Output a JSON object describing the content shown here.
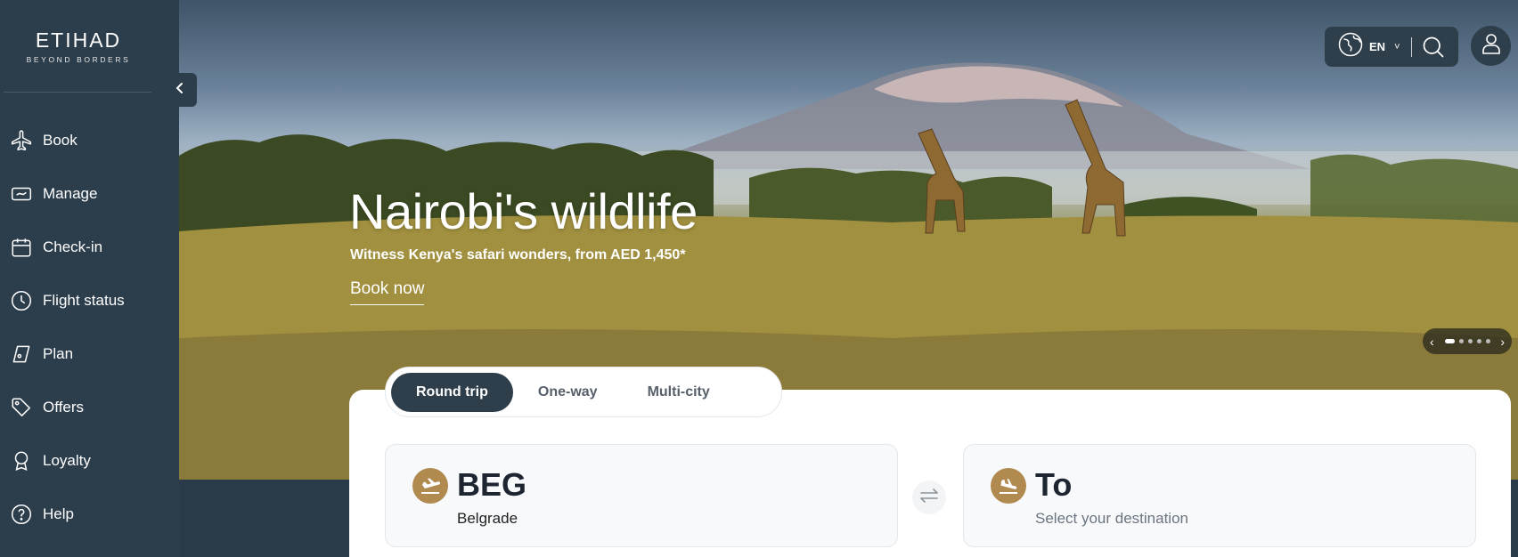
{
  "brand": {
    "name": "ETIHAD",
    "tagline": "BEYOND BORDERS"
  },
  "sidebar": {
    "items": [
      {
        "label": "Book",
        "icon": "plane-icon"
      },
      {
        "label": "Manage",
        "icon": "ticket-icon"
      },
      {
        "label": "Check-in",
        "icon": "calendar-icon"
      },
      {
        "label": "Flight status",
        "icon": "clock-icon"
      },
      {
        "label": "Plan",
        "icon": "tag-icon"
      },
      {
        "label": "Offers",
        "icon": "price-tag-icon"
      },
      {
        "label": "Loyalty",
        "icon": "award-icon"
      },
      {
        "label": "Help",
        "icon": "question-icon"
      }
    ]
  },
  "header": {
    "language": "EN"
  },
  "hero": {
    "title": "Nairobi's wildlife",
    "subtitle": "Witness Kenya's safari wonders, from AED 1,450*",
    "cta": "Book now",
    "carousel_slides": 5,
    "carousel_active": 1
  },
  "booking": {
    "tabs": [
      "Round trip",
      "One-way",
      "Multi-city"
    ],
    "active_tab": "Round trip",
    "from": {
      "code": "BEG",
      "city": "Belgrade"
    },
    "to": {
      "code": "To",
      "city": "Select your destination"
    }
  },
  "colors": {
    "sidebar": "#2c3d4b",
    "accent_gold": "#b08a4e",
    "active_tab": "#2e3e4b"
  }
}
